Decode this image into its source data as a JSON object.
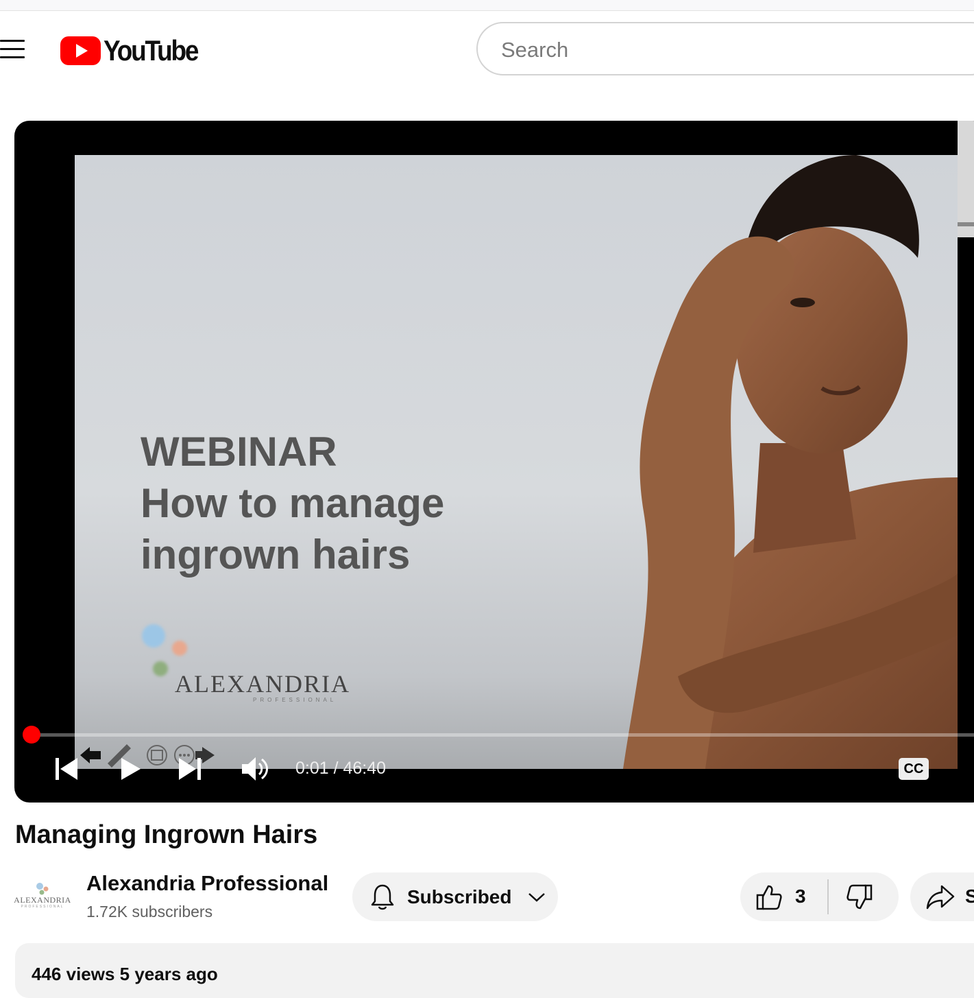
{
  "header": {
    "logo_text": "YouTube",
    "search_placeholder": "Search"
  },
  "player": {
    "slide": {
      "line1": "WEBINAR",
      "line2": "How to manage",
      "line3": "ingrown hairs",
      "brand_name": "ALEXANDRIA",
      "brand_sub": "PROFESSIONAL"
    },
    "time_display": "0:01 / 46:40",
    "cc_label": "CC",
    "progress_fraction": 0.0004
  },
  "video": {
    "title": "Managing Ingrown Hairs",
    "channel": {
      "name": "Alexandria Professional",
      "subscribers": "1.72K subscribers",
      "avatar_text": "ALEXANDRIA",
      "avatar_sub": "PROFESSIONAL"
    },
    "subscribe_label": "Subscribed",
    "like_count": "3",
    "share_label": "Share",
    "meta": "446 views  5 years ago"
  },
  "colors": {
    "brand_red": "#ff0000",
    "pill_bg": "#f2f2f2",
    "slide_text": "#555555"
  }
}
